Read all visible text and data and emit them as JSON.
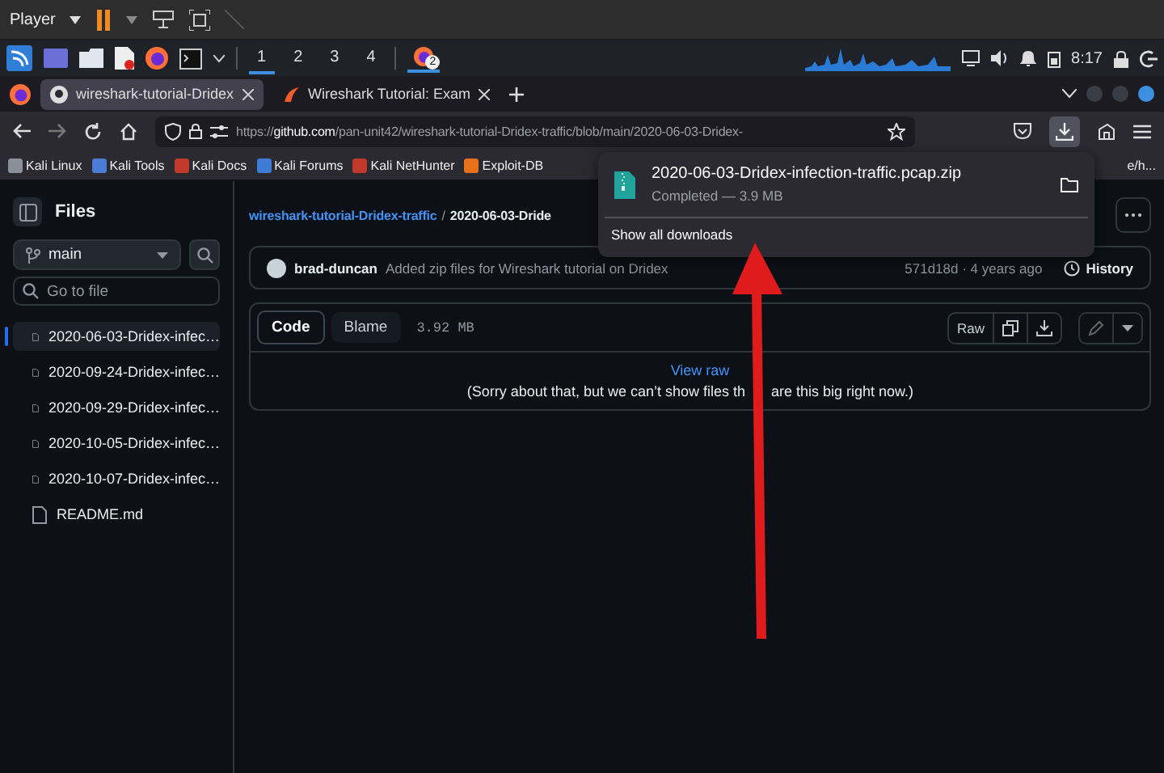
{
  "vm_toolbar": {
    "menu": "Player"
  },
  "taskbar": {
    "workspaces": [
      {
        "label": "1",
        "selected": true
      },
      {
        "label": "2",
        "selected": false
      },
      {
        "label": "3",
        "selected": false
      },
      {
        "label": "4",
        "selected": false
      }
    ],
    "badge": "2",
    "clock": "8:17"
  },
  "browser": {
    "tabs": [
      {
        "title": "wireshark-tutorial-Dridex",
        "selected": true
      },
      {
        "title": "Wireshark Tutorial: Exam",
        "selected": false
      }
    ],
    "url_prefix": "https://",
    "url_host": "github.com",
    "url_path": "/pan-unit42/wireshark-tutorial-Dridex-traffic/blob/main/2020-06-03-Dridex-",
    "bookmarks": [
      "Kali Linux",
      "Kali Tools",
      "Kali Docs",
      "Kali Forums",
      "Kali NetHunter",
      "Exploit-DB"
    ],
    "bookmark_overflow": "e/h..."
  },
  "downloads_panel": {
    "items": [
      {
        "filename": "2020-06-03-Dridex-infection-traffic.pcap.zip",
        "status": "Completed — 3.9 MB"
      }
    ],
    "show_all": "Show all downloads"
  },
  "sidebar": {
    "title": "Files",
    "branch": "main",
    "search_placeholder": "Go to file",
    "files": [
      {
        "name": "2020-06-03-Dridex-infec…",
        "selected": true
      },
      {
        "name": "2020-09-24-Dridex-infec…",
        "selected": false
      },
      {
        "name": "2020-09-29-Dridex-infec…",
        "selected": false
      },
      {
        "name": "2020-10-05-Dridex-infec…",
        "selected": false
      },
      {
        "name": "2020-10-07-Dridex-infec…",
        "selected": false
      },
      {
        "name": "README.md",
        "selected": false
      }
    ]
  },
  "file_view": {
    "repo": "wireshark-tutorial-Dridex-traffic",
    "separator": "/",
    "file": "2020-06-03-Dride",
    "commit": {
      "author": "brad-duncan",
      "message": "Added zip files for Wireshark tutorial on Dridex",
      "meta": "571d18d · 4 years ago",
      "history": "History"
    },
    "tabs": [
      {
        "label": "Code",
        "selected": true
      },
      {
        "label": "Blame",
        "selected": false
      }
    ],
    "size": "3.92 MB",
    "raw": "Raw",
    "view_raw": "View raw",
    "notice": [
      "(Sorry about that, but we can’t show files th",
      "are this big right now.)"
    ]
  }
}
